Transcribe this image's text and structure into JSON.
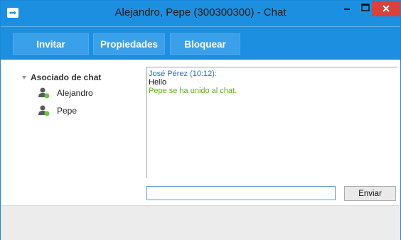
{
  "window": {
    "title": "Alejandro, Pepe (300300300) - Chat",
    "accent_color": "#1c8fe0",
    "close_color": "#d9413a",
    "controls": {
      "minimize": "minimize-icon",
      "maximize": "maximize-icon",
      "close": "close-icon"
    }
  },
  "toolbar": {
    "invite_label": "Invitar",
    "properties_label": "Propiedades",
    "block_label": "Bloquear"
  },
  "sidebar": {
    "group_label": "Asociado de chat",
    "contacts": [
      {
        "name": "Alejandro",
        "icon": "user-online-icon",
        "status_color": "#6cc24a"
      },
      {
        "name": "Pepe",
        "icon": "user-online-icon",
        "status_color": "#6cc24a"
      }
    ]
  },
  "chat": {
    "messages": [
      {
        "sender": "José Pérez (10:12):",
        "text": "Hello"
      },
      {
        "system": "Pepe se ha unido al chat."
      }
    ],
    "input_value": "",
    "send_label": "Enviar"
  }
}
